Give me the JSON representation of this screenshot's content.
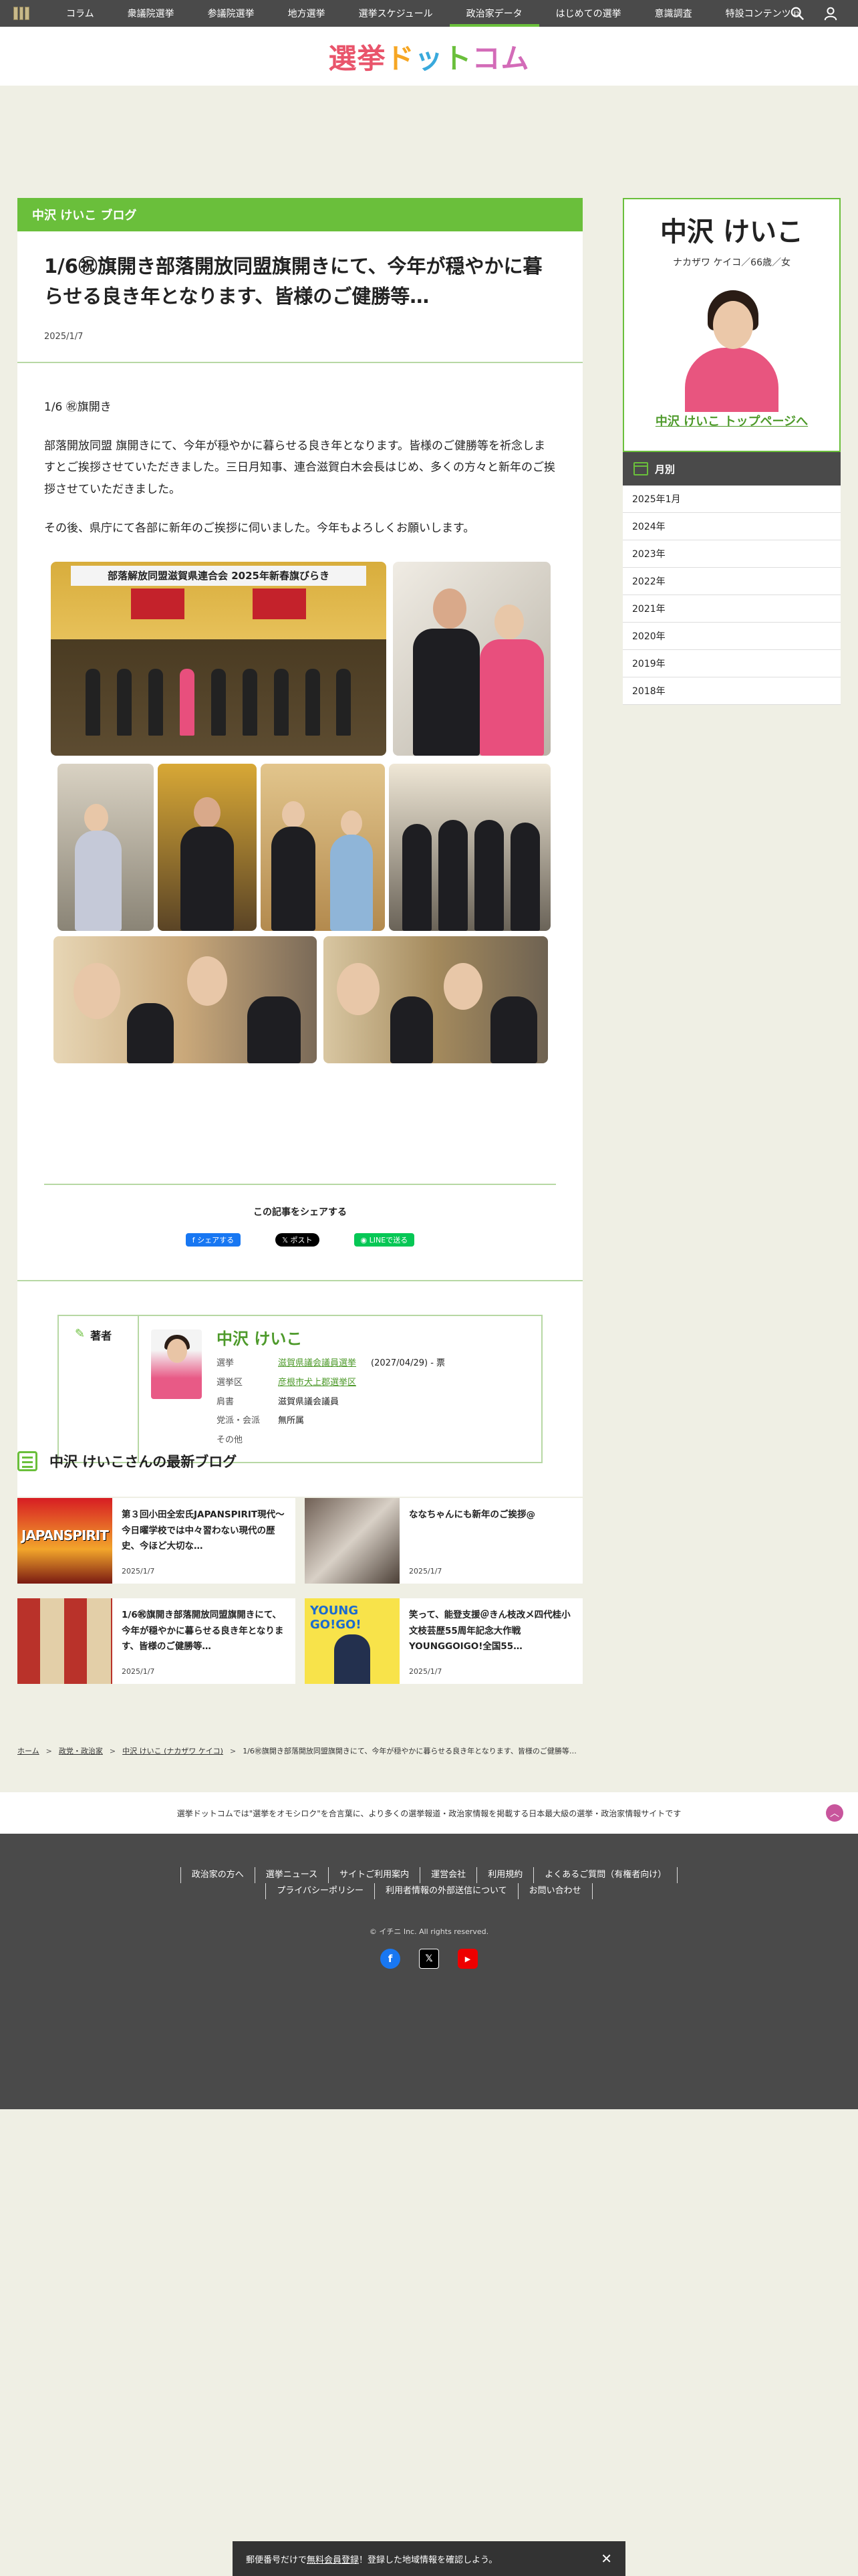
{
  "nav": {
    "items": [
      "コラム",
      "衆議院選挙",
      "参議院選挙",
      "地方選挙",
      "選挙スケジュール",
      "政治家データ",
      "はじめての選挙",
      "意識調査",
      "特設コンテンツ"
    ],
    "active_index": 5,
    "icons": [
      "menu-icon",
      "search-icon",
      "user-icon",
      "external-link-icon"
    ]
  },
  "logo": {
    "text": "選挙ドットコム"
  },
  "article": {
    "category": "中沢 けいこ ブログ",
    "title": "1/6㊗旗開き部落開放同盟旗開きにて、今年が穏やかに暮らせる良き年となります、皆様のご健勝等…",
    "date": "2025/1/7",
    "paragraphs": [
      "1/6 ㊗旗開き",
      "部落開放同盟 旗開きにて、今年が穏やかに暮らせる良き年となります。皆様のご健勝等を祈念しますとご挨拶させていただきました。三日月知事、連合滋賀白木会長はじめ、多くの方々と新年のご挨拶させていただきました。",
      "その後、県庁にて各部に新年のご挨拶に伺いました。今年もよろしくお願いします。"
    ],
    "photo_banner": "部落解放同盟滋賀県連合会 2025年新春旗びらき"
  },
  "share": {
    "label": "この記事をシェアする",
    "facebook": "シェアする",
    "x": "ポスト",
    "line": "LINEで送る"
  },
  "author": {
    "label": "著者",
    "name": "中沢 けいこ",
    "rows": [
      {
        "key": "選挙",
        "value": "滋賀県議会議員選挙",
        "extra": "(2027/04/29) - 票"
      },
      {
        "key": "選挙区",
        "value": "彦根市犬上郡選挙区",
        "extra": ""
      },
      {
        "key": "肩書",
        "value": "滋賀県議会議員",
        "extra": ""
      },
      {
        "key": "党派・会派",
        "value": "無所属",
        "extra": ""
      },
      {
        "key": "その他",
        "value": "",
        "extra": ""
      }
    ]
  },
  "latest": {
    "heading": "中沢 けいこさんの最新ブログ",
    "cards": [
      {
        "title": "第３回小田全宏氏JAPANSPIRIT現代〜今日曜学校では中々習わない現代の歴史、今ほど大切な…",
        "date": "2025/1/7",
        "thumb_text": "JAPANSPIRIT"
      },
      {
        "title": "ななちゃんにも新年のご挨拶@",
        "date": "2025/1/7",
        "thumb_text": ""
      },
      {
        "title": "1/6㊗旗開き部落開放同盟旗開きにて、今年が穏やかに暮らせる良き年となります、皆様のご健勝等…",
        "date": "2025/1/7",
        "thumb_text": ""
      },
      {
        "title": "笑って、能登支援＠きん枝改メ四代桂小文枝芸歴55周年記念大作戦YOUNGGOIGO!全国55…",
        "date": "2025/1/7",
        "thumb_text": "YOUNG GO!GO!"
      }
    ]
  },
  "breadcrumb": [
    "ホーム",
    "政党・政治家",
    "中沢 けいこ (ナカザワ ケイコ)",
    "1/6㊗旗開き部落開放同盟旗開きにて、今年が穏やかに暮らせる良き年となります、皆様のご健勝等…"
  ],
  "footer": {
    "tagline": "選挙ドットコムでは\"選挙をオモシロク\"を合言葉に、より多くの選挙報道・政治家情報を掲載する日本最大級の選挙・政治家情報サイトです",
    "links_row1": [
      "政治家の方へ",
      "選挙ニュース",
      "サイトご利用案内",
      "運営会社",
      "利用規約",
      "よくあるご質問（有権者向け）"
    ],
    "links_row2": [
      "プライバシーポリシー",
      "利用者情報の外部送信について",
      "お問い合わせ"
    ],
    "copyright": "© イチニ Inc. All rights reserved."
  },
  "bottom_bar": {
    "pre": "郵便番号だけで",
    "link": "無料会員登録",
    "post": "！登録した地域情報を確認しよう。"
  },
  "profile": {
    "name": "中沢 けいこ",
    "kana": "ナカザワ ケイコ／66歳／女",
    "top_link": "中沢 けいこ トップページへ"
  },
  "monthly": {
    "heading": "月別",
    "months": [
      "2025年1月",
      "2024年",
      "2023年",
      "2022年",
      "2021年",
      "2020年",
      "2019年",
      "2018年"
    ]
  },
  "colors": {
    "accent_green": "#6abf3b",
    "nav_bg": "#4a4a4a",
    "page_bg": "#efefe4",
    "link_green": "#4e9a2b"
  }
}
